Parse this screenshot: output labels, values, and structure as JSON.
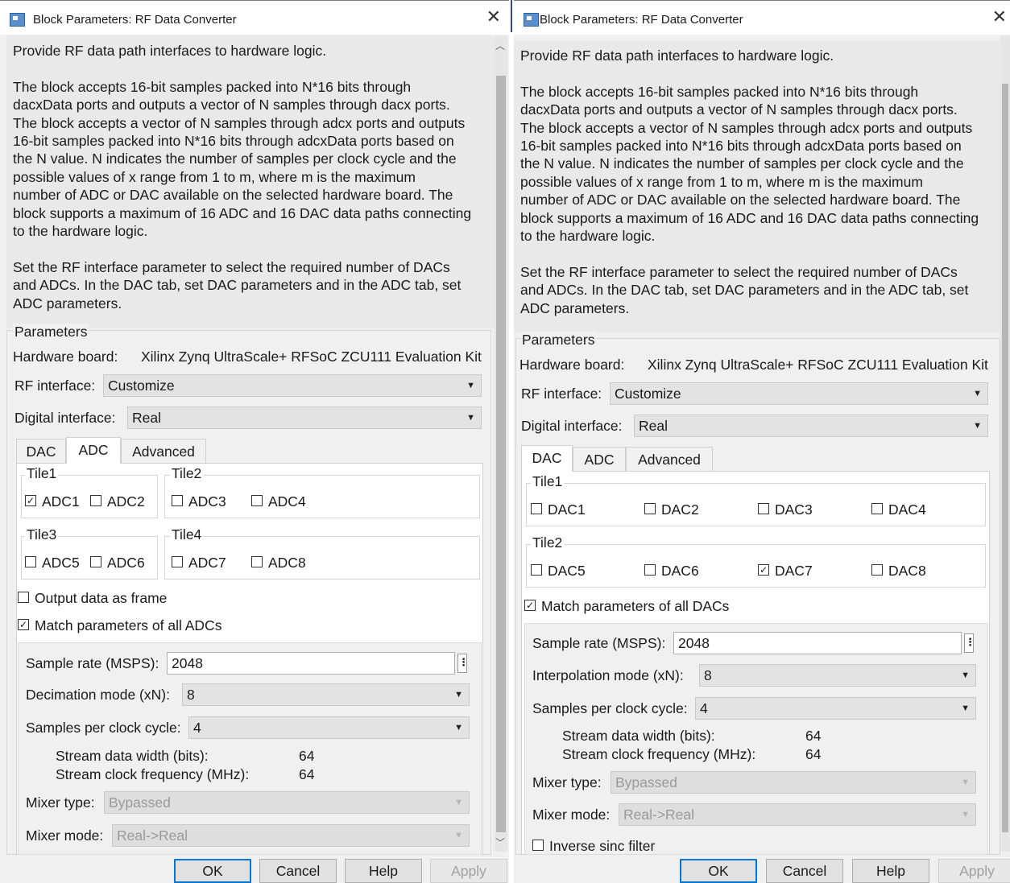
{
  "left": {
    "title": "Block Parameters: RF Data Converter",
    "description": "Provide RF data path interfaces to hardware logic.\n\nThe block accepts 16-bit samples packed into N*16 bits through\ndacxData ports and outputs a vector of N samples through dacx ports.\nThe block accepts a vector of N samples through adcx ports and outputs\n16-bit samples packed into N*16 bits through adcxData ports based on\nthe N value. N indicates the number of samples per clock cycle and the\npossible values of x range from 1 to m, where m is the maximum\nnumber of ADC or DAC available on the selected hardware board. The\nblock supports a maximum of 16 ADC and 16 DAC data paths connecting\nto the hardware logic.\n\nSet the RF interface parameter to select the required number of DACs\nand ADCs. In the DAC tab, set DAC parameters and in the ADC tab, set\nADC parameters.",
    "parameters_label": "Parameters",
    "hardware_label": "Hardware board:",
    "hardware_value": "Xilinx Zynq UltraScale+ RFSoC ZCU111 Evaluation Kit",
    "rf_interface_label": "RF interface:",
    "rf_interface_value": "Customize",
    "digital_interface_label": "Digital interface:",
    "digital_interface_value": "Real",
    "tabs": [
      "DAC",
      "ADC",
      "Advanced"
    ],
    "selected_tab": "ADC",
    "tiles": [
      {
        "name": "Tile1",
        "items": [
          {
            "label": "ADC1",
            "checked": true
          },
          {
            "label": "ADC2",
            "checked": false
          }
        ]
      },
      {
        "name": "Tile2",
        "items": [
          {
            "label": "ADC3",
            "checked": false
          },
          {
            "label": "ADC4",
            "checked": false
          }
        ]
      },
      {
        "name": "Tile3",
        "items": [
          {
            "label": "ADC5",
            "checked": false
          },
          {
            "label": "ADC6",
            "checked": false
          }
        ]
      },
      {
        "name": "Tile4",
        "items": [
          {
            "label": "ADC7",
            "checked": false
          },
          {
            "label": "ADC8",
            "checked": false
          }
        ]
      }
    ],
    "output_frame": {
      "label": "Output data as frame",
      "checked": false
    },
    "match_params": {
      "label": "Match parameters of all ADCs",
      "checked": true
    },
    "sample_rate": {
      "label": "Sample rate (MSPS):",
      "value": "2048"
    },
    "decimation": {
      "label": "Decimation mode (xN):",
      "value": "8"
    },
    "samples_per_clock": {
      "label": "Samples per clock cycle:",
      "value": "4"
    },
    "stream_width": {
      "label": "Stream data width (bits):",
      "value": "64"
    },
    "stream_clock": {
      "label": "Stream clock frequency (MHz):",
      "value": "64"
    },
    "mixer_type": {
      "label": "Mixer type:",
      "value": "Bypassed"
    },
    "mixer_mode": {
      "label": "Mixer mode:",
      "value": "Real->Real"
    },
    "buttons": {
      "ok": "OK",
      "cancel": "Cancel",
      "help": "Help",
      "apply": "Apply"
    },
    "scroll_position": 0.1
  },
  "right": {
    "title": "Block Parameters: RF Data Converter",
    "description": "Provide RF data path interfaces to hardware logic.\n\nThe block accepts 16-bit samples packed into N*16 bits through\ndacxData ports and outputs a vector of N samples through dacx ports.\nThe block accepts a vector of N samples through adcx ports and outputs\n16-bit samples packed into N*16 bits through adcxData ports based on\nthe N value. N indicates the number of samples per clock cycle and the\npossible values of x range from 1 to m, where m is the maximum\nnumber of ADC or DAC available on the selected hardware board. The\nblock supports a maximum of 16 ADC and 16 DAC data paths connecting\nto the hardware logic.\n\nSet the RF interface parameter to select the required number of DACs\nand ADCs. In the DAC tab, set DAC parameters and in the ADC tab, set\nADC parameters.",
    "parameters_label": "Parameters",
    "hardware_label": "Hardware board:",
    "hardware_value": "Xilinx Zynq UltraScale+ RFSoC ZCU111 Evaluation Kit",
    "rf_interface_label": "RF interface:",
    "rf_interface_value": "Customize",
    "digital_interface_label": "Digital interface:",
    "digital_interface_value": "Real",
    "tabs": [
      "DAC",
      "ADC",
      "Advanced"
    ],
    "selected_tab": "DAC",
    "tiles": [
      {
        "name": "Tile1",
        "items": [
          {
            "label": "DAC1",
            "checked": false
          },
          {
            "label": "DAC2",
            "checked": false
          },
          {
            "label": "DAC3",
            "checked": false
          },
          {
            "label": "DAC4",
            "checked": false
          }
        ]
      },
      {
        "name": "Tile2",
        "items": [
          {
            "label": "DAC5",
            "checked": false
          },
          {
            "label": "DAC6",
            "checked": false
          },
          {
            "label": "DAC7",
            "checked": true
          },
          {
            "label": "DAC8",
            "checked": false
          }
        ]
      }
    ],
    "match_params": {
      "label": "Match parameters of all DACs",
      "checked": true
    },
    "sample_rate": {
      "label": "Sample rate (MSPS):",
      "value": "2048"
    },
    "interpolation": {
      "label": "Interpolation mode (xN):",
      "value": "8"
    },
    "samples_per_clock": {
      "label": "Samples per clock cycle:",
      "value": "4"
    },
    "stream_width": {
      "label": "Stream data width (bits):",
      "value": "64"
    },
    "stream_clock": {
      "label": "Stream clock frequency (MHz):",
      "value": "64"
    },
    "mixer_type": {
      "label": "Mixer type:",
      "value": "Bypassed"
    },
    "mixer_mode": {
      "label": "Mixer mode:",
      "value": "Real->Real"
    },
    "inverse_sinc": {
      "label": "Inverse sinc filter",
      "checked": false
    },
    "buttons": {
      "ok": "OK",
      "cancel": "Cancel",
      "help": "Help",
      "apply": "Apply"
    }
  },
  "icons": {
    "close": "close-icon",
    "app": "simulink-block-icon",
    "dropdown": "chevron-down-icon",
    "ellipsis": "vertical-ellipsis-icon",
    "checkmark": "checkmark-icon"
  }
}
